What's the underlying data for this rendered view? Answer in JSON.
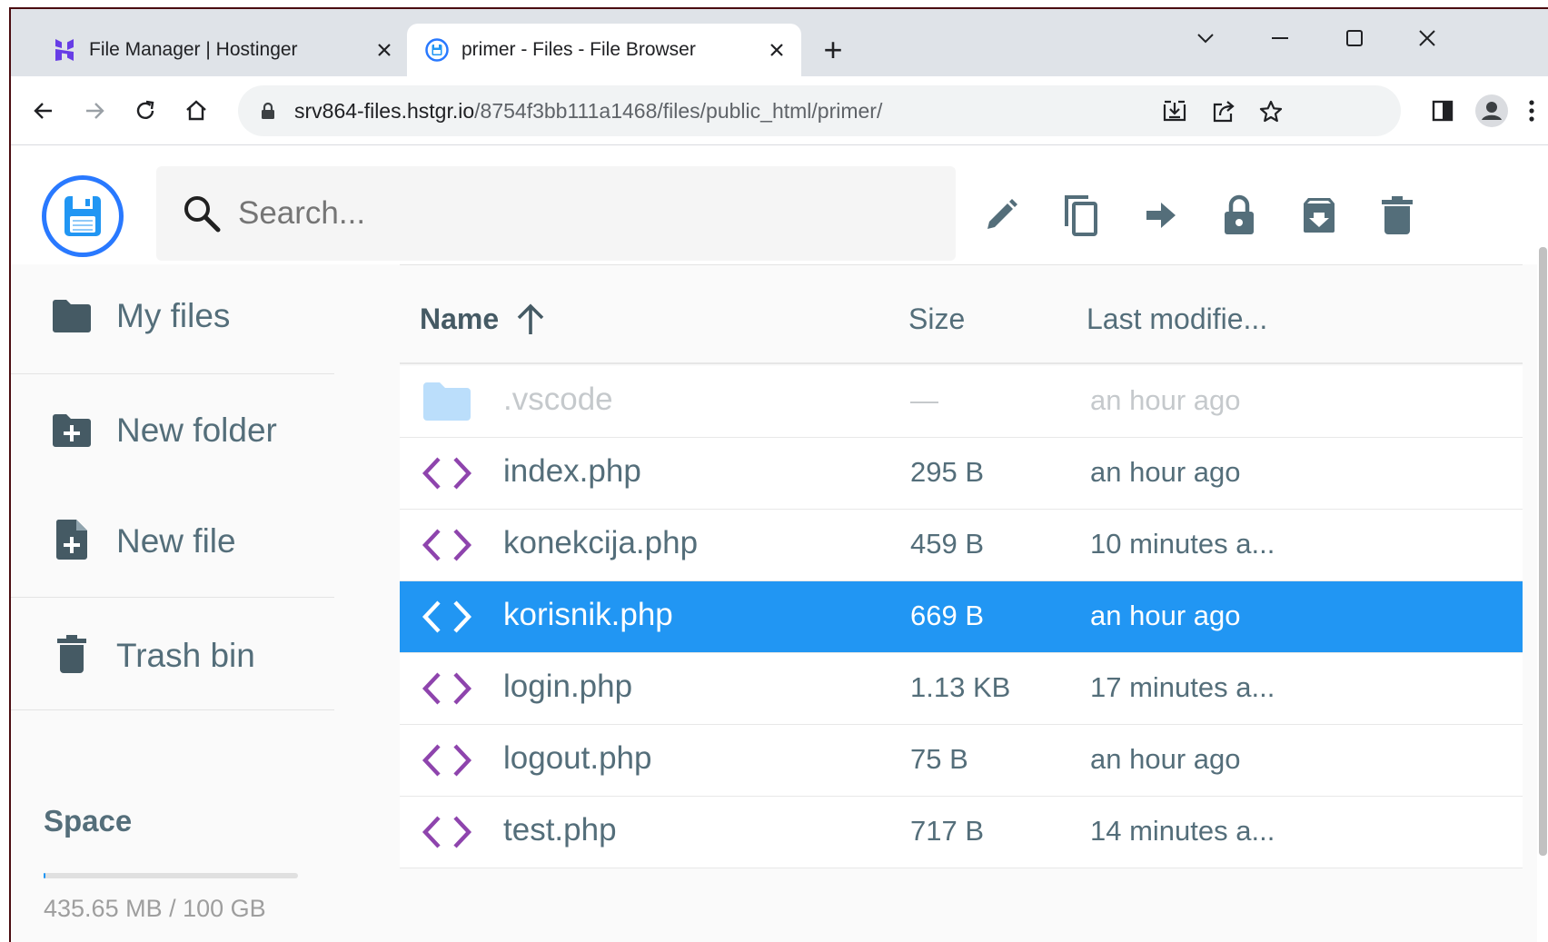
{
  "browser": {
    "tabs": [
      {
        "title": "File Manager | Hostinger",
        "favicon": "hostinger-logo-icon"
      },
      {
        "title": "primer - Files - File Browser",
        "favicon": "filebrowser-logo-icon"
      }
    ],
    "new_tab": "+",
    "url_host": "srv864-files.hstgr.io",
    "url_path": "/8754f3bb111a1468/files/public_html/primer/"
  },
  "search": {
    "placeholder": "Search..."
  },
  "header_actions": [
    "edit-icon",
    "copy-icon",
    "move-icon",
    "permissions-icon",
    "archive-icon",
    "delete-icon"
  ],
  "sidebar": {
    "items": [
      {
        "label": "My files",
        "icon": "folder-icon"
      },
      {
        "label": "New folder",
        "icon": "new-folder-icon"
      },
      {
        "label": "New file",
        "icon": "new-file-icon"
      },
      {
        "label": "Trash bin",
        "icon": "trash-icon"
      }
    ],
    "space_title": "Space",
    "space_text": "435.65 MB / 100 GB",
    "space_used_fraction": 0.0044
  },
  "listing": {
    "columns": {
      "name": "Name",
      "size": "Size",
      "modified": "Last modifie..."
    },
    "rows": [
      {
        "name": ".vscode",
        "size": "—",
        "modified": "an hour ago",
        "type": "folder",
        "state": "dim"
      },
      {
        "name": "index.php",
        "size": "295 B",
        "modified": "an hour ago",
        "type": "code",
        "state": "normal"
      },
      {
        "name": "konekcija.php",
        "size": "459 B",
        "modified": "10 minutes a...",
        "type": "code",
        "state": "normal"
      },
      {
        "name": "korisnik.php",
        "size": "669 B",
        "modified": "an hour ago",
        "type": "code",
        "state": "selected"
      },
      {
        "name": "login.php",
        "size": "1.13 KB",
        "modified": "17 minutes a...",
        "type": "code",
        "state": "normal"
      },
      {
        "name": "logout.php",
        "size": "75 B",
        "modified": "an hour ago",
        "type": "code",
        "state": "normal"
      },
      {
        "name": "test.php",
        "size": "717 B",
        "modified": "14 minutes a...",
        "type": "code",
        "state": "normal"
      }
    ]
  },
  "colors": {
    "accent": "#2196f3",
    "code_icon": "#8e44ad",
    "text": "#546e7a"
  }
}
